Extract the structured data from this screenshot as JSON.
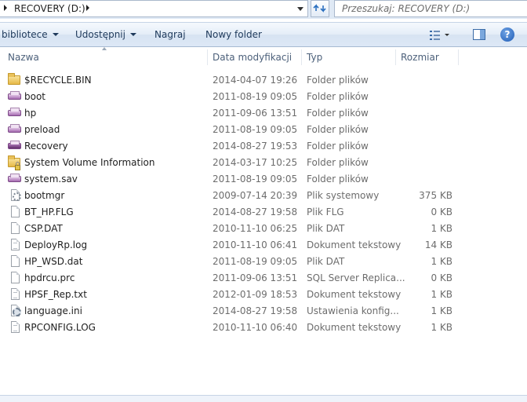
{
  "address": {
    "path": "RECOVERY (D:)",
    "search_placeholder": "Przeszukaj: RECOVERY (D:)"
  },
  "toolbar": {
    "organize_label": "bibliotece",
    "share_label": "Udostępnij",
    "burn_label": "Nagraj",
    "new_folder_label": "Nowy folder"
  },
  "columns": {
    "name": "Nazwa",
    "date": "Data modyfikacji",
    "type": "Typ",
    "size": "Rozmiar"
  },
  "files": [
    {
      "name": "$RECYCLE.BIN",
      "date": "2014-04-07 19:26",
      "type": "Folder plików",
      "size": "",
      "icon": "folder-icon"
    },
    {
      "name": "boot",
      "date": "2011-08-19 09:05",
      "type": "Folder plików",
      "size": "",
      "icon": "hidden-folder-icon"
    },
    {
      "name": "hp",
      "date": "2011-09-06 13:51",
      "type": "Folder plików",
      "size": "",
      "icon": "hidden-folder-icon"
    },
    {
      "name": "preload",
      "date": "2011-08-19 09:05",
      "type": "Folder plików",
      "size": "",
      "icon": "hidden-folder-icon"
    },
    {
      "name": "Recovery",
      "date": "2014-08-27 19:53",
      "type": "Folder plików",
      "size": "",
      "icon": "hidden-folder-icon"
    },
    {
      "name": "System Volume Information",
      "date": "2014-03-17 10:25",
      "type": "Folder plików",
      "size": "",
      "icon": "locked-folder-icon"
    },
    {
      "name": "system.sav",
      "date": "2011-08-19 09:05",
      "type": "Folder plików",
      "size": "",
      "icon": "hidden-folder-icon"
    },
    {
      "name": "bootmgr",
      "date": "2009-07-14 20:39",
      "type": "Plik systemowy",
      "size": "375 KB",
      "icon": "system-file-icon"
    },
    {
      "name": "BT_HP.FLG",
      "date": "2014-08-27 19:58",
      "type": "Plik FLG",
      "size": "0 KB",
      "icon": "file-icon"
    },
    {
      "name": "CSP.DAT",
      "date": "2010-11-10 06:25",
      "type": "Plik DAT",
      "size": "1 KB",
      "icon": "file-icon"
    },
    {
      "name": "DeployRp.log",
      "date": "2010-11-10 06:41",
      "type": "Dokument tekstowy",
      "size": "14 KB",
      "icon": "text-file-icon"
    },
    {
      "name": "HP_WSD.dat",
      "date": "2011-08-19 09:05",
      "type": "Plik DAT",
      "size": "1 KB",
      "icon": "file-icon"
    },
    {
      "name": "hpdrcu.prc",
      "date": "2011-09-06 13:51",
      "type": "SQL Server Replica...",
      "size": "0 KB",
      "icon": "file-icon"
    },
    {
      "name": "HPSF_Rep.txt",
      "date": "2012-01-09 18:53",
      "type": "Dokument tekstowy",
      "size": "1 KB",
      "icon": "text-file-icon"
    },
    {
      "name": "language.ini",
      "date": "2014-08-27 19:58",
      "type": "Ustawienia konfig...",
      "size": "1 KB",
      "icon": "config-file-icon"
    },
    {
      "name": "RPCONFIG.LOG",
      "date": "2010-11-10 06:40",
      "type": "Dokument tekstowy",
      "size": "1 KB",
      "icon": "text-file-icon"
    }
  ]
}
